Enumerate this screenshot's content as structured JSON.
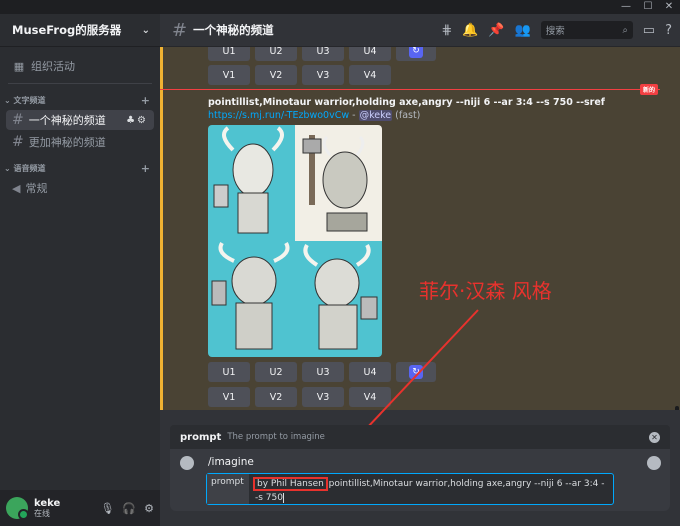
{
  "window": {
    "minimize": "—",
    "maximize": "☐",
    "close": "✕"
  },
  "sidebar": {
    "server_name": "MuseFrog的服务器",
    "events_label": "组织活动",
    "text_category": "文字频道",
    "voice_category": "语音频道",
    "text_channels": [
      {
        "name": "一个神秘的频道",
        "active": true
      },
      {
        "name": "更加神秘的频道",
        "active": false
      }
    ],
    "voice_channels": [
      {
        "name": "常规"
      }
    ],
    "user": {
      "name": "keke",
      "status": "在线"
    }
  },
  "header": {
    "channel_name": "一个神秘的频道",
    "search_placeholder": "搜索"
  },
  "messages": {
    "top_buttons": {
      "upscale": [
        "U1",
        "U2",
        "U3",
        "U4"
      ],
      "variation": [
        "V1",
        "V2",
        "V3",
        "V4"
      ]
    },
    "new_badge": "新的",
    "prompt_text": "pointillist,Minotaur warrior,holding axe,angry --niji 6 --ar 3:4 --s 750 --sref",
    "link": "https://s.mj.run/-TEzbwo0vCw",
    "separator": " - ",
    "mention": "@keke",
    "mode": "(fast)",
    "bottom_buttons": {
      "upscale": [
        "U1",
        "U2",
        "U3",
        "U4"
      ],
      "variation": [
        "V1",
        "V2",
        "V3",
        "V4"
      ]
    }
  },
  "annotation": "菲尔·汉森 风格",
  "command_popup": {
    "name": "prompt",
    "description": "The prompt to imagine"
  },
  "composer": {
    "command": "/imagine",
    "field_label": "prompt",
    "highlighted": "by Phil Hansen",
    "value_rest": " pointillist,Minotaur warrior,holding axe,angry --niji 6 --ar 3:4 --s 750"
  },
  "colors": {
    "accent_blue": "#5865f2",
    "link_blue": "#00a8fc",
    "annotation_red": "#e8322d",
    "reply_bar": "#f0b232",
    "image_bg": "#4fc3d0"
  }
}
